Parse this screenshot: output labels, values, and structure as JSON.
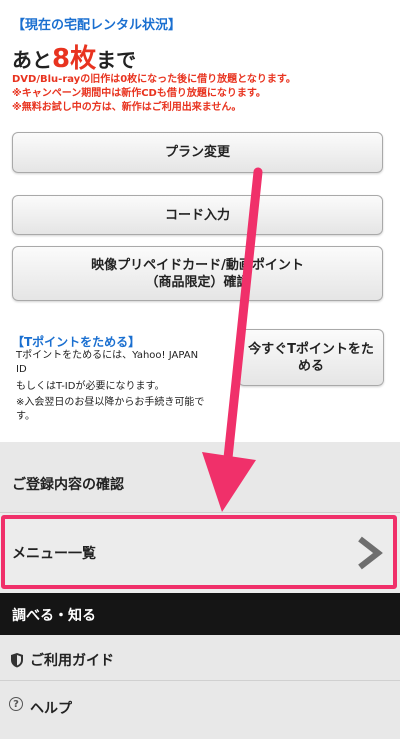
{
  "rental_status": {
    "title": "【現在の宅配レンタル状況】",
    "remaining_prefix": "あと",
    "remaining_count": "8枚",
    "remaining_suffix": "まで",
    "notes": [
      "DVD/Blu-rayの旧作は0枚になった後に借り放題となります。",
      "※キャンペーン期間中は新作CDも借り放題になります。",
      "※無料お試し中の方は、新作はご利用出来ません。"
    ]
  },
  "buttons": {
    "plan_change": "プラン変更",
    "code_input": "コード入力",
    "video_prepaid_line1": "映像プリペイドカード/動画ポイント",
    "video_prepaid_line2": "（商品限定）確認"
  },
  "tpoint": {
    "title": "【Tポイントをためる】",
    "description": [
      "Tポイントをためるには、Yahoo! JAPAN",
      "ID",
      "もしくはT-IDが必要になります。",
      "※入会翌日のお昼以降からお手続き可能で",
      "す。"
    ],
    "button_line1": "今すぐTポイントをた",
    "button_line2": "める"
  },
  "menu": {
    "confirm_registration": "ご登録内容の確認",
    "menu_list": "メニュー一覧",
    "section_header": "調べる・知る",
    "guide": "ご利用ガイド",
    "help": "ヘルプ",
    "help_icon_glyph": "?"
  },
  "colors": {
    "accent_blue": "#1a6fd0",
    "warning_red": "#e8331f",
    "highlight_pink": "#f0306a",
    "section_bar": "#151515"
  },
  "icons": {
    "menu_chevron": "chevron-right-icon",
    "guide": "shield-icon",
    "help": "question-circle-icon",
    "annotation": "arrow-icon"
  }
}
